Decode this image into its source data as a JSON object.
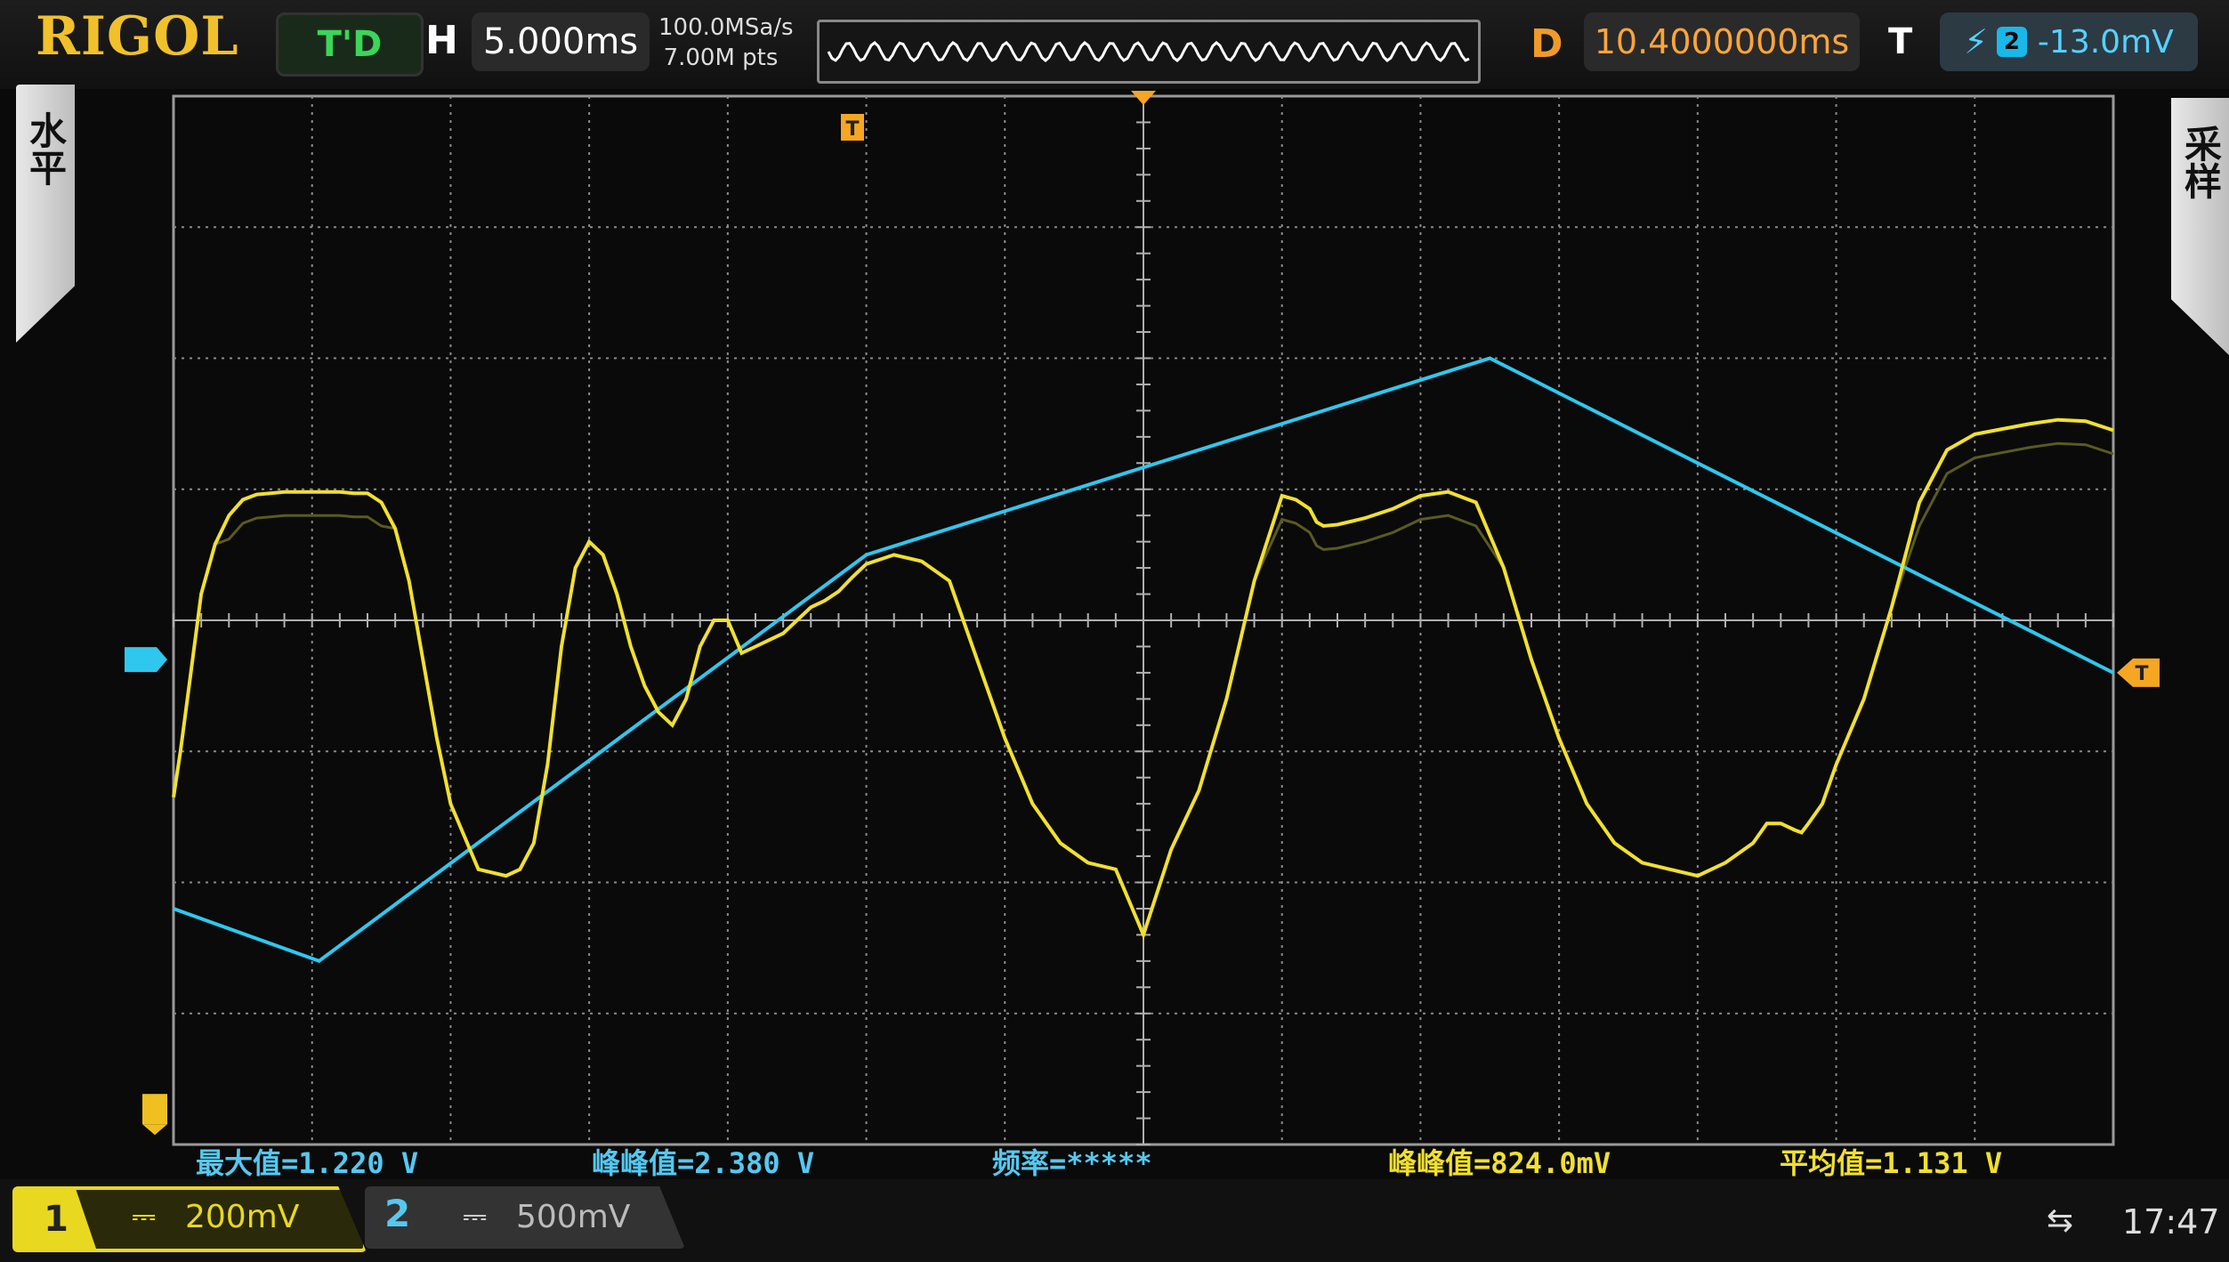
{
  "header": {
    "brand": "RIGOL",
    "run_status": "T'D",
    "horizontal_label": "H",
    "timebase": "5.000ms",
    "sample_rate": "100.0MSa/s",
    "memory_depth": "7.00M pts",
    "delay_label": "D",
    "delay": "10.4000000ms",
    "trigger_label": "T",
    "trigger_source": "2",
    "trigger_level": "-13.0mV"
  },
  "menus": {
    "left": "水平",
    "right": "采样"
  },
  "markers": {
    "trigger": "T"
  },
  "measurements": {
    "m1": "最大值=1.220 V",
    "m2": "峰峰值=2.380 V",
    "m3": "频率=*****",
    "m4": "峰峰值=824.0mV",
    "m5": "平均值=1.131 V"
  },
  "channels": {
    "ch1_num": "1",
    "ch1_coupling": "⎓",
    "ch1_scale": "200mV",
    "ch2_num": "2",
    "ch2_coupling": "⎓",
    "ch2_scale": "500mV"
  },
  "status": {
    "usb_icon": "⇆",
    "time": "17:47"
  },
  "colors": {
    "ch1": "#f0e030",
    "ch2": "#2fc7ee",
    "grid": "#9a9a9a",
    "trigger": "#f5a623"
  },
  "chart_data": {
    "type": "line",
    "timebase_per_div": "5.000ms",
    "series": [
      {
        "name": "1",
        "x": [
          0,
          0.05,
          0.1,
          0.2,
          0.3,
          0.4,
          0.5,
          0.6,
          0.7,
          0.8,
          0.9,
          1.0,
          1.1,
          1.2,
          1.3,
          1.4,
          1.5,
          1.6,
          1.7,
          1.8,
          1.9,
          2.0,
          2.2,
          2.4,
          2.5,
          2.6,
          2.7,
          2.8,
          2.9,
          3.0,
          3.1,
          3.2,
          3.3,
          3.4,
          3.5,
          3.6,
          3.7,
          3.8,
          3.9,
          4.0,
          4.1,
          4.2,
          4.3,
          4.4,
          4.5,
          4.6,
          4.7,
          4.8,
          4.9,
          5.0,
          5.2,
          5.4,
          5.6,
          5.8,
          6.0,
          6.2,
          6.4,
          6.6,
          6.8,
          7.0,
          7.2,
          7.4,
          7.6,
          7.8,
          8.0,
          8.1,
          8.2,
          8.25,
          8.3,
          8.4,
          8.6,
          8.8,
          9.0,
          9.2,
          9.4,
          9.6,
          9.8,
          10.0,
          10.2,
          10.4,
          10.6,
          10.8,
          11.0,
          11.2,
          11.4,
          11.5,
          11.6,
          11.7,
          11.75,
          11.8,
          11.9,
          12.0,
          12.2,
          12.4,
          12.6,
          12.8,
          13.0,
          13.2,
          13.4,
          13.6,
          13.8,
          14.0
        ],
        "y": [
          -1.35,
          -1.0,
          -0.6,
          0.2,
          0.58,
          0.8,
          0.92,
          0.96,
          0.97,
          0.98,
          0.98,
          0.98,
          0.98,
          0.98,
          0.97,
          0.97,
          0.9,
          0.7,
          0.3,
          -0.3,
          -0.9,
          -1.4,
          -1.9,
          -1.95,
          -1.9,
          -1.7,
          -1.1,
          -0.2,
          0.4,
          0.6,
          0.5,
          0.2,
          -0.2,
          -0.5,
          -0.7,
          -0.8,
          -0.6,
          -0.2,
          0.0,
          0.0,
          -0.25,
          -0.2,
          -0.15,
          -0.1,
          0.0,
          0.1,
          0.15,
          0.22,
          0.33,
          0.43,
          0.5,
          0.45,
          0.3,
          -0.3,
          -0.9,
          -1.4,
          -1.7,
          -1.85,
          -1.9,
          -2.4,
          -1.75,
          -1.3,
          -0.6,
          0.3,
          0.95,
          0.92,
          0.85,
          0.75,
          0.72,
          0.73,
          0.78,
          0.85,
          0.95,
          0.98,
          0.9,
          0.4,
          -0.3,
          -0.9,
          -1.4,
          -1.7,
          -1.85,
          -1.9,
          -1.95,
          -1.85,
          -1.7,
          -1.55,
          -1.55,
          -1.6,
          -1.62,
          -1.55,
          -1.4,
          -1.1,
          -0.6,
          0.1,
          0.9,
          1.3,
          1.42,
          1.46,
          1.5,
          1.53,
          1.52,
          1.45
        ]
      },
      {
        "name": "2",
        "x": [
          0,
          1.05,
          5.0,
          9.5,
          14.0
        ],
        "y": [
          -2.2,
          -2.6,
          0.5,
          2.0,
          -0.4
        ]
      }
    ],
    "trigger_level": -0.4
  }
}
